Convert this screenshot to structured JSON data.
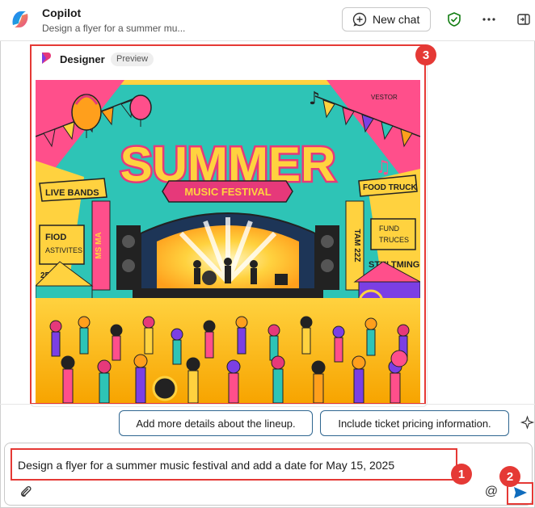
{
  "header": {
    "title": "Copilot",
    "subtitle": "Design a flyer for a summer mu...",
    "new_chat_label": "New chat",
    "icons": [
      "copilot-logo",
      "new-chat-icon",
      "shield-check-icon",
      "more-options-icon",
      "side-panel-icon"
    ],
    "accent": "#107c10"
  },
  "response": {
    "source_label": "Designer",
    "badge_label": "Preview",
    "image": {
      "title_main": "SUMMER",
      "title_banner": "MUSIC FESTIVAL",
      "left_signs": [
        "LIVE BANDS",
        "FIOD",
        "ASTIVITES",
        "2EDUIL"
      ],
      "right_signs": [
        "FOOD TRUCK",
        "FUND",
        "TRUCES",
        "STULTMING"
      ],
      "pillar_left": "MS MA",
      "pillar_right": "TAM 22Z",
      "corner_text": "VESTOR"
    }
  },
  "suggestions": [
    "Add more details about the lineup.",
    "Include ticket pricing information."
  ],
  "composer": {
    "value": "Design a flyer for a summer music festival and add a date for May 15, 2025",
    "icons": [
      "attach-icon",
      "mention-icon",
      "send-icon"
    ],
    "send_color": "#0f6cbd"
  },
  "annotations": [
    "1",
    "2",
    "3"
  ],
  "colors": {
    "annotation_red": "#e53935",
    "chip_border": "#2f6690"
  }
}
